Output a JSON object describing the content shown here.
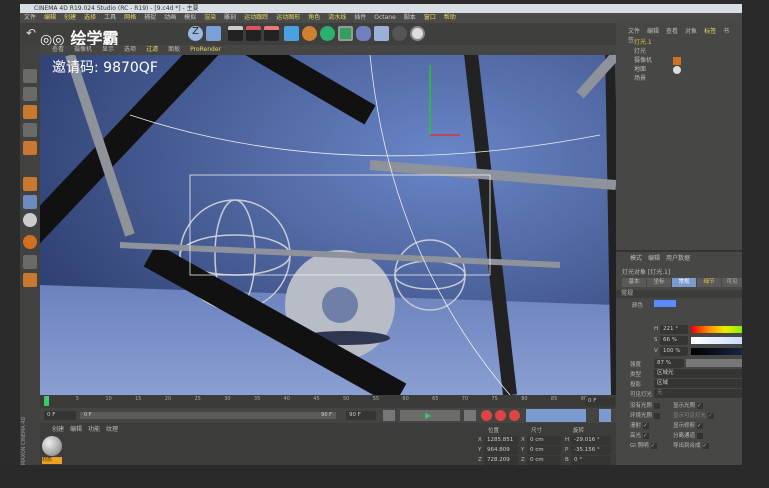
{
  "window": {
    "title": "CINEMA 4D R19.024 Studio (RC - R19) - [9.c4d *] - 主要"
  },
  "menu": [
    "文件",
    "编辑",
    "创建",
    "选择",
    "工具",
    "网格",
    "捕捉",
    "动画",
    "模拟",
    "渲染",
    "雕刻",
    "运动跟踪",
    "运动图形",
    "角色",
    "流水线",
    "插件",
    "Octane",
    "脚本",
    "窗口",
    "帮助"
  ],
  "watermark": {
    "brand": "绘学霸",
    "invite": "邀请码: 9870QF"
  },
  "viewport": {
    "tabs": [
      "查看",
      "摄像机",
      "显示",
      "选项",
      "过滤",
      "面板",
      "ProRender"
    ]
  },
  "object_manager": {
    "menu": [
      "文件",
      "编辑",
      "查看",
      "对象",
      "标签",
      "书签"
    ],
    "objects": [
      {
        "name": "灯光.1",
        "active": true
      },
      {
        "name": "灯光"
      },
      {
        "name": "摄像机"
      },
      {
        "name": "地面"
      },
      {
        "name": "场景"
      }
    ]
  },
  "attributes": {
    "menu": [
      "模式",
      "编辑",
      "用户数据"
    ],
    "object_title": "灯光对象 [灯光.1]",
    "tabs": [
      "基本",
      "坐标",
      "常规",
      "细节",
      "可见"
    ],
    "active_tab": "常规",
    "section": "常规",
    "color_label": "颜色",
    "color": "#5a8cff",
    "h_label": "H",
    "h": "221 °",
    "s_label": "S",
    "s": "66 %",
    "v_label": "V",
    "v": "100 %",
    "intensity_label": "强度",
    "intensity": "87 %",
    "intensity_fraction": 0.87,
    "type_label": "类型",
    "type": "区域光",
    "shadow_label": "投影",
    "shadow": "区域",
    "visible_light_label": "可见灯光",
    "visible_light": "无",
    "checks_left": [
      {
        "label": "没有光照",
        "checked": false
      },
      {
        "label": "环境光照",
        "checked": false
      },
      {
        "label": "漫射",
        "checked": true
      },
      {
        "label": "高光",
        "checked": true
      },
      {
        "label": "GI 照明",
        "checked": true
      }
    ],
    "checks_right": [
      {
        "label": "显示光照",
        "checked": true
      },
      {
        "label": "显示可见灯光",
        "checked": true
      },
      {
        "label": "显示修剪",
        "checked": true
      },
      {
        "label": "分离通道",
        "checked": false
      },
      {
        "label": "导出到合成",
        "checked": true
      }
    ]
  },
  "timeline": {
    "ticks": [
      "0",
      "5",
      "10",
      "15",
      "20",
      "25",
      "30",
      "35",
      "40",
      "45",
      "50",
      "55",
      "60",
      "65",
      "70",
      "75",
      "80",
      "85",
      "90"
    ],
    "current": "0 F",
    "start": "0 F",
    "range_start": "0 F",
    "range_end": "90 F",
    "end": "90 F"
  },
  "material_manager": {
    "menu": [
      "创建",
      "编辑",
      "功能",
      "纹理"
    ],
    "materials": [
      "材质"
    ]
  },
  "coordinates": {
    "headers": [
      "位置",
      "尺寸",
      "旋转"
    ],
    "rows": [
      {
        "axis": "X",
        "pos": "1285.851 cm",
        "size_axis": "X",
        "size": "0 cm",
        "rot_axis": "H",
        "rot": "-29.016 °"
      },
      {
        "axis": "Y",
        "pos": "964.809 cm",
        "size_axis": "Y",
        "size": "0 cm",
        "rot_axis": "P",
        "rot": "-35.156 °"
      },
      {
        "axis": "Z",
        "pos": "728.209 cm",
        "size_axis": "Z",
        "size": "0 cm",
        "rot_axis": "B",
        "rot": "0 °"
      }
    ]
  },
  "side_logo": "MAXON CINEMA 4D"
}
